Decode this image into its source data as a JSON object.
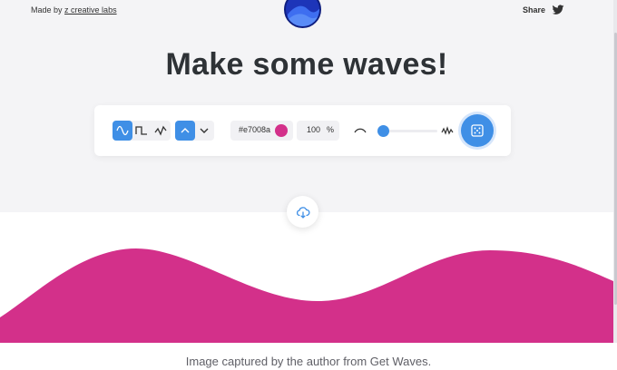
{
  "header": {
    "made_by_prefix": "Made by",
    "made_by_link": "z creative labs",
    "share_label": "Share"
  },
  "hero": {
    "title": "Make some waves!"
  },
  "toolbar": {
    "wave_types": [
      {
        "icon": "sine-wave-icon",
        "active": true
      },
      {
        "icon": "square-wave-icon",
        "active": false
      },
      {
        "icon": "triangle-wave-icon",
        "active": false
      }
    ],
    "direction": [
      {
        "icon": "chevron-up-icon",
        "active": true
      },
      {
        "icon": "chevron-down-icon",
        "active": false
      }
    ],
    "color_hex": "#e7008a",
    "opacity_value": "100",
    "opacity_unit": "%",
    "complexity_level": 0.0
  },
  "wave": {
    "color": "#d3308a"
  },
  "caption": "Image captured by the author from Get Waves."
}
